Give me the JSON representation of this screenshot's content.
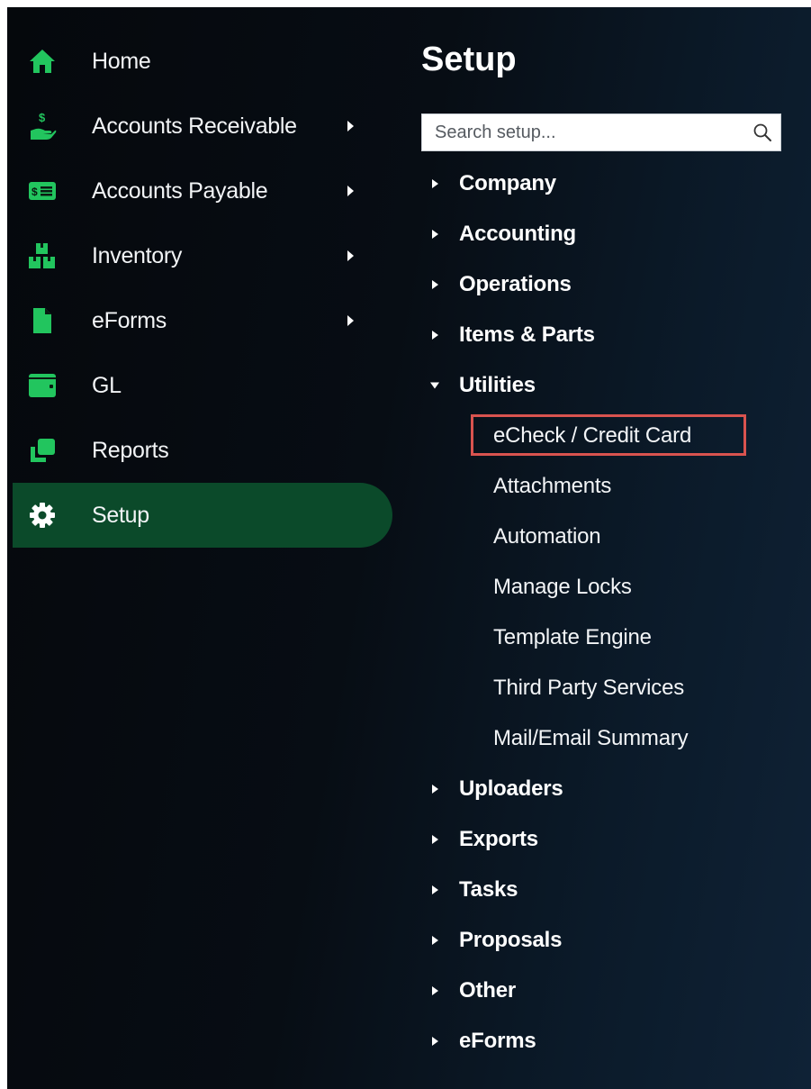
{
  "nav": {
    "items": [
      {
        "label": "Home",
        "icon": "home-icon",
        "has_submenu": false,
        "active": false
      },
      {
        "label": "Accounts Receivable",
        "icon": "money-hand-icon",
        "has_submenu": true,
        "active": false
      },
      {
        "label": "Accounts Payable",
        "icon": "bill-icon",
        "has_submenu": true,
        "active": false
      },
      {
        "label": "Inventory",
        "icon": "boxes-icon",
        "has_submenu": true,
        "active": false
      },
      {
        "label": "eForms",
        "icon": "document-icon",
        "has_submenu": true,
        "active": false
      },
      {
        "label": "GL",
        "icon": "wallet-icon",
        "has_submenu": false,
        "active": false
      },
      {
        "label": "Reports",
        "icon": "clone-icon",
        "has_submenu": false,
        "active": false
      },
      {
        "label": "Setup",
        "icon": "gear-icon",
        "has_submenu": false,
        "active": true
      }
    ]
  },
  "setup": {
    "title": "Setup",
    "search_placeholder": "Search setup...",
    "sections": [
      {
        "label": "Company",
        "expanded": false
      },
      {
        "label": "Accounting",
        "expanded": false
      },
      {
        "label": "Operations",
        "expanded": false
      },
      {
        "label": "Items & Parts",
        "expanded": false
      },
      {
        "label": "Utilities",
        "expanded": true
      },
      {
        "label": "Uploaders",
        "expanded": false
      },
      {
        "label": "Exports",
        "expanded": false
      },
      {
        "label": "Tasks",
        "expanded": false
      },
      {
        "label": "Proposals",
        "expanded": false
      },
      {
        "label": "Other",
        "expanded": false
      },
      {
        "label": "eForms",
        "expanded": false
      }
    ],
    "utilities_items": [
      {
        "label": "eCheck / Credit Card",
        "highlighted": true
      },
      {
        "label": "Attachments",
        "highlighted": false
      },
      {
        "label": "Automation",
        "highlighted": false
      },
      {
        "label": "Manage Locks",
        "highlighted": false
      },
      {
        "label": "Template Engine",
        "highlighted": false
      },
      {
        "label": "Third Party Services",
        "highlighted": false
      },
      {
        "label": "Mail/Email Summary",
        "highlighted": false
      }
    ]
  },
  "colors": {
    "icon_green": "#22c55e",
    "active_bg": "#0b4a2a",
    "highlight_border": "#d9534f"
  }
}
